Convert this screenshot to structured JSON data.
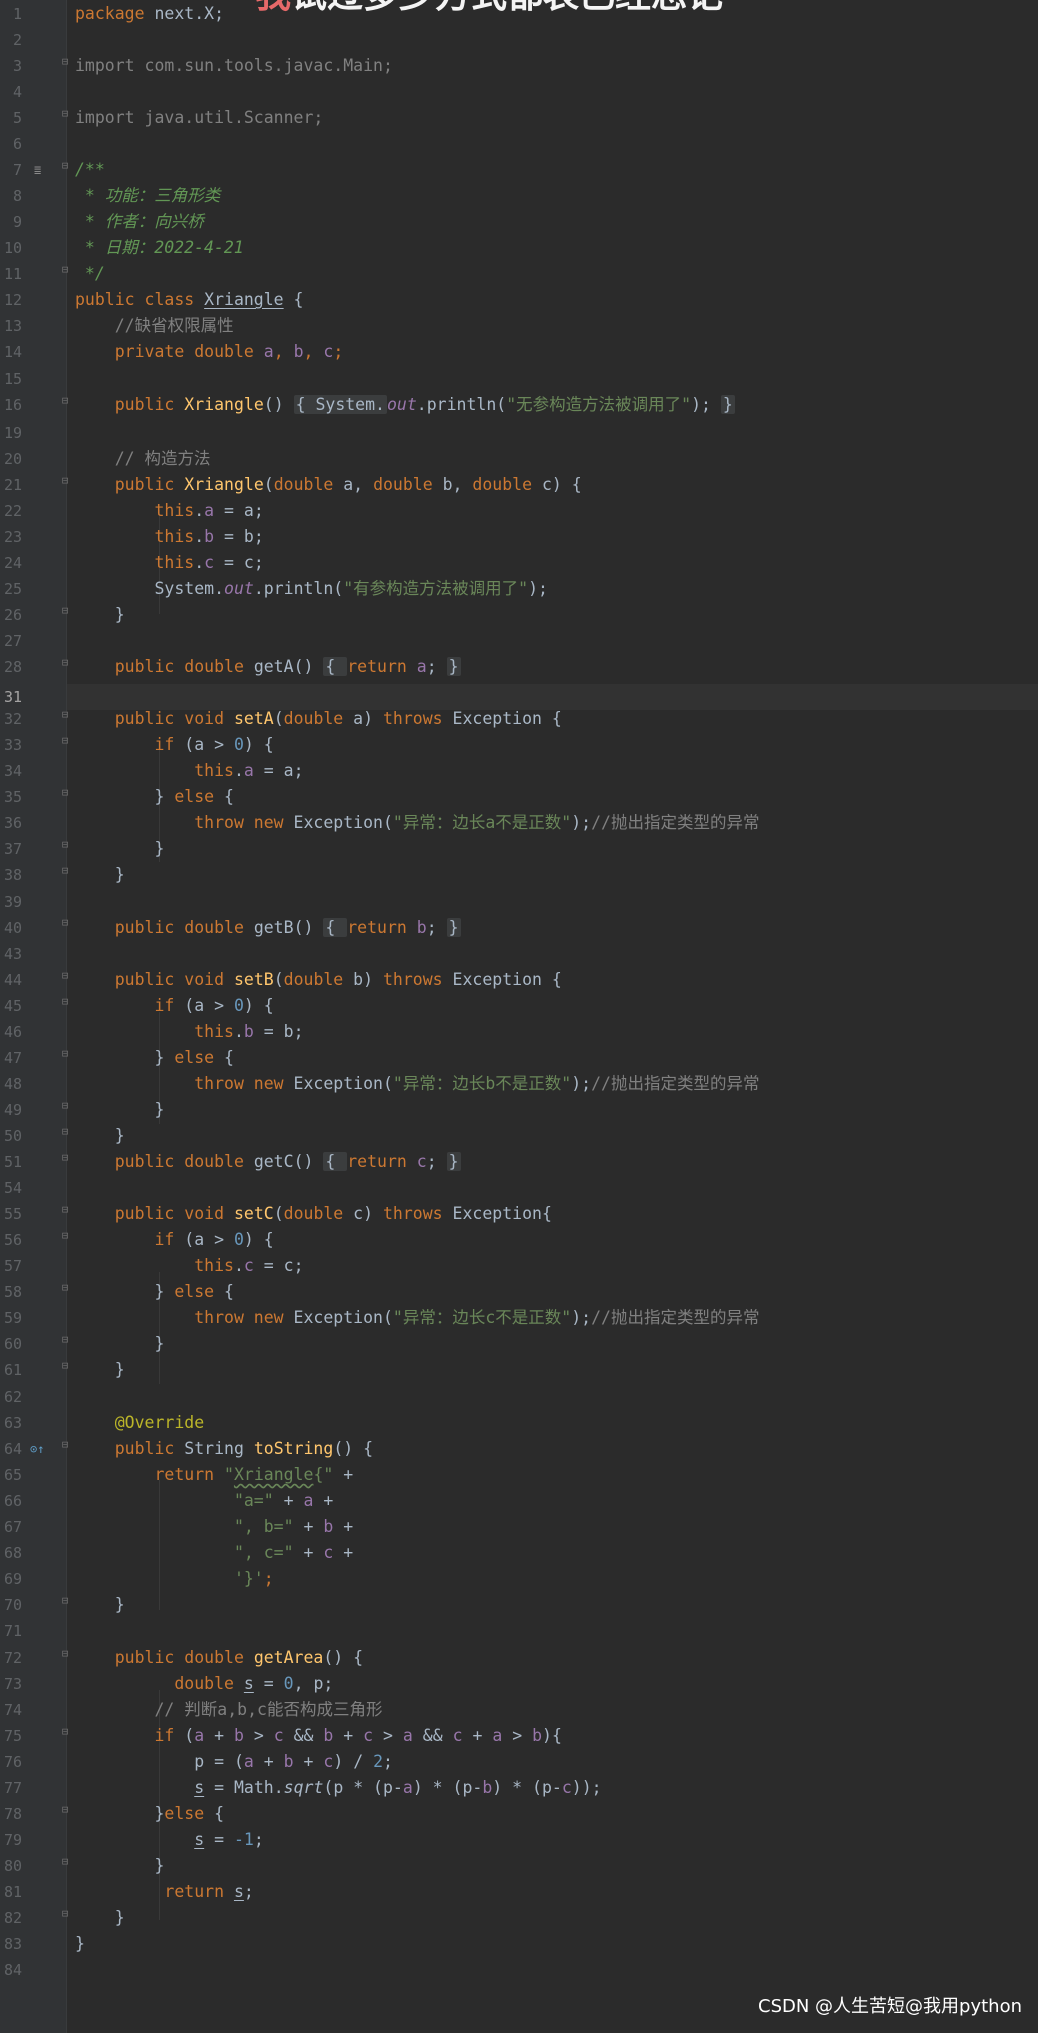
{
  "editor": {
    "line_numbers": [
      "1",
      "2",
      "3",
      "4",
      "5",
      "6",
      "7",
      "8",
      "9",
      "10",
      "11",
      "12",
      "13",
      "14",
      "15",
      "16",
      "19",
      "20",
      "21",
      "22",
      "23",
      "24",
      "25",
      "26",
      "27",
      "28",
      "31",
      "32",
      "33",
      "34",
      "35",
      "36",
      "37",
      "38",
      "39",
      "40",
      "43",
      "44",
      "45",
      "46",
      "47",
      "48",
      "49",
      "50",
      "51",
      "54",
      "55",
      "56",
      "57",
      "58",
      "59",
      "60",
      "61",
      "62",
      "63",
      "64",
      "65",
      "66",
      "67",
      "68",
      "69",
      "70",
      "71",
      "72",
      "73",
      "74",
      "75",
      "76",
      "77",
      "78",
      "79",
      "80",
      "81",
      "82",
      "83",
      "84"
    ],
    "current_line_number": "31",
    "top_overlay": {
      "highlight": "我",
      "text": "试过多少方式都表已经忘记"
    },
    "lines": {
      "l1_kw": "package",
      "l1_rest": " next.X;",
      "l3": "import com.sun.tools.javac.Main;",
      "l5": "import java.util.Scanner;",
      "l7": "/**",
      "l8": " * 功能：三角形类",
      "l9": " * 作者：向兴桥",
      "l10": " * 日期：2022-4-21",
      "l11": " */",
      "l12_kw": "public class ",
      "l12_name": "Xriangle",
      "l12_rest": " {",
      "l13": "    //缺省权限属性",
      "l14_kw": "    private double ",
      "l14_f1": "a",
      "l14_s1": ", ",
      "l14_f2": "b",
      "l14_s2": ", ",
      "l14_f3": "c",
      "l14_end": ";",
      "l16_kw": "    public ",
      "l16_m": "Xriangle",
      "l16_p": "()",
      "l16_box1": "{ System.",
      "l16_out": "out",
      "l16_pr": ".println(",
      "l16_str": "\"无参构造方法被调用了\"",
      "l16_end": ");",
      "l16_box2": "}",
      "l20": "    // 构造方法",
      "l21_kw": "    public ",
      "l21_m": "Xriangle",
      "l21_p1": "(",
      "l21_t1": "double",
      "l21_a": " a, ",
      "l21_t2": "double",
      "l21_b": " b, ",
      "l21_t3": "double",
      "l21_c": " c) {",
      "l22_this": "        this",
      "l22_dot": ".",
      "l22_f": "a",
      "l22_rest": " = a;",
      "l23_this": "        this",
      "l23_dot": ".",
      "l23_f": "b",
      "l23_rest": " = b;",
      "l24_this": "        this",
      "l24_dot": ".",
      "l24_f": "c",
      "l24_rest": " = c;",
      "l25_a": "        System.",
      "l25_out": "out",
      "l25_pr": ".println(",
      "l25_str": "\"有参构造方法被调用了\"",
      "l25_end": ");",
      "l26": "    }",
      "l28_kw": "    public double ",
      "l28_m": "getA",
      "l28_p": "()",
      "l28_box1": "{ ",
      "l28_ret": "return ",
      "l28_f": "a",
      "l28_semi": "; ",
      "l28_box2": "}",
      "l32_kw": "    public void ",
      "l32_m": "setA",
      "l32_p1": "(",
      "l32_t": "double",
      "l32_p2": " a) ",
      "l32_th": "throws",
      "l32_ex": " Exception {",
      "l33_if": "        if",
      "l33_p": " (a > ",
      "l33_n": "0",
      "l33_end": ") {",
      "l34_this": "            this",
      "l34_dot": ".",
      "l34_f": "a",
      "l34_rest": " = a;",
      "l35_a": "        } ",
      "l35_else": "else",
      "l35_b": " {",
      "l36_th": "            throw new",
      "l36_ex": " Exception(",
      "l36_str": "\"异常：边长a不是正数\"",
      "l36_end": ");",
      "l36_cmt": "//抛出指定类型的异常",
      "l37": "        }",
      "l38": "    }",
      "l40_kw": "    public double ",
      "l40_m": "getB",
      "l40_p": "()",
      "l40_box1": "{ ",
      "l40_ret": "return ",
      "l40_f": "b",
      "l40_semi": "; ",
      "l40_box2": "}",
      "l44_kw": "    public void ",
      "l44_m": "setB",
      "l44_p1": "(",
      "l44_t": "double",
      "l44_p2": " b) ",
      "l44_th": "throws",
      "l44_ex": " Exception {",
      "l45_if": "        if",
      "l45_p": " (a > ",
      "l45_n": "0",
      "l45_end": ") {",
      "l46_this": "            this",
      "l46_dot": ".",
      "l46_f": "b",
      "l46_rest": " = b;",
      "l47_a": "        } ",
      "l47_else": "else",
      "l47_b": " {",
      "l48_th": "            throw new",
      "l48_ex": " Exception(",
      "l48_str": "\"异常：边长b不是正数\"",
      "l48_end": ");",
      "l48_cmt": "//抛出指定类型的异常",
      "l49": "        }",
      "l50": "    }",
      "l51_kw": "    public double ",
      "l51_m": "getC",
      "l51_p": "()",
      "l51_box1": "{ ",
      "l51_ret": "return ",
      "l51_f": "c",
      "l51_semi": "; ",
      "l51_box2": "}",
      "l55_kw": "    public void ",
      "l55_m": "setC",
      "l55_p1": "(",
      "l55_t": "double",
      "l55_p2": " c) ",
      "l55_th": "throws",
      "l55_ex": " Exception{",
      "l56_if": "        if",
      "l56_p": " (a > ",
      "l56_n": "0",
      "l56_end": ") {",
      "l57_this": "            this",
      "l57_dot": ".",
      "l57_f": "c",
      "l57_rest": " = c;",
      "l58_a": "        } ",
      "l58_else": "else",
      "l58_b": " {",
      "l59_th": "            throw new",
      "l59_ex": " Exception(",
      "l59_str": "\"异常：边长c不是正数\"",
      "l59_end": ");",
      "l59_cmt": "//抛出指定类型的异常",
      "l60": "        }",
      "l61": "    }",
      "l63": "    @Override",
      "l64_kw": "    public",
      "l64_t": " String ",
      "l64_m": "toString",
      "l64_end": "() {",
      "l65_ret": "        return ",
      "l65_q": "\"",
      "l65_n": "Xriangle",
      "l65_s": "{\"",
      "l65_plus": " +",
      "l66_str": "                \"a=\"",
      "l66_mid": " + ",
      "l66_f": "a",
      "l66_plus": " +",
      "l67_str": "                \", b=\"",
      "l67_mid": " + ",
      "l67_f": "b",
      "l67_plus": " +",
      "l68_str": "                \", c=\"",
      "l68_mid": " + ",
      "l68_f": "c",
      "l68_plus": " +",
      "l69_str": "                '}'",
      "l69_end": ";",
      "l70": "    }",
      "l72_kw": "    public double ",
      "l72_m": "getArea",
      "l72_end": "() {",
      "l73_kw": "          double ",
      "l73_s": "s",
      "l73_eq": " = ",
      "l73_n": "0",
      "l73_rest": ", p;",
      "l74": "        // 判断a,b,c能否构成三角形",
      "l75_if": "        if",
      "l75_a": " (",
      "l75_f1": "a",
      "l75_b": " + ",
      "l75_f2": "b",
      "l75_c": " > ",
      "l75_f3": "c",
      "l75_d": " && ",
      "l75_f4": "b",
      "l75_e": " + ",
      "l75_f5": "c",
      "l75_f": " > ",
      "l75_f6": "a",
      "l75_g": " && ",
      "l75_f7": "c",
      "l75_h": " + ",
      "l75_f8": "a",
      "l75_i": " > ",
      "l75_f9": "b",
      "l75_end": "){",
      "l76_a": "            p = (",
      "l76_f1": "a",
      "l76_b": " + ",
      "l76_f2": "b",
      "l76_c": " + ",
      "l76_f3": "c",
      "l76_d": ") / ",
      "l76_n": "2",
      "l76_end": ";",
      "l77_ind": "            ",
      "l77_s": "s",
      "l77_a": " = Math.",
      "l77_sq": "sqrt",
      "l77_b": "(p * (p-",
      "l77_f1": "a",
      "l77_c": ") * (p-",
      "l77_f2": "b",
      "l77_d": ") * (p-",
      "l77_f3": "c",
      "l77_end": "));",
      "l78_a": "        }",
      "l78_else": "else",
      "l78_b": " {",
      "l79_ind": "            ",
      "l79_s": "s",
      "l79_a": " = ",
      "l79_n": "-1",
      "l79_end": ";",
      "l80": "        }",
      "l81_ret": "         return ",
      "l81_s": "s",
      "l81_end": ";",
      "l82": "    }",
      "l83": "}"
    }
  },
  "watermark": "CSDN @人生苦短@我用python"
}
